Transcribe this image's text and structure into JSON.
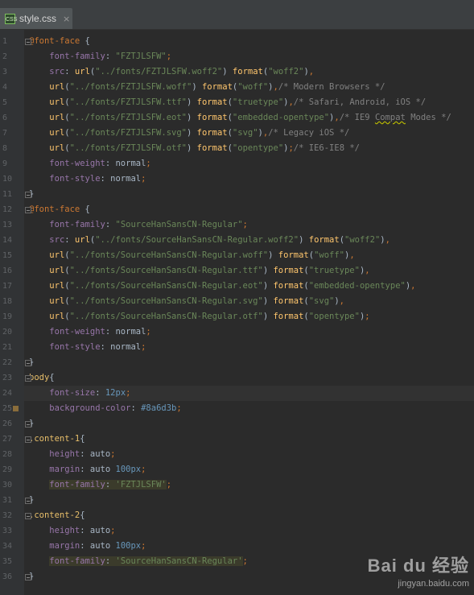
{
  "tab": {
    "icon": "css-file-icon",
    "icon_text": "CSS",
    "label": "style.css",
    "close": "×"
  },
  "watermark": {
    "logo": "Bai du 经验",
    "url": "jingyan.baidu.com"
  },
  "swatch_color": "#8a6d3b",
  "lines": [
    {
      "n": "1",
      "fold": true,
      "tokens": [
        [
          "at",
          "@font-face"
        ],
        [
          "plain",
          " {"
        ]
      ]
    },
    {
      "n": "2",
      "tokens": [
        [
          "sp",
          "    "
        ],
        [
          "prop",
          "font-family"
        ],
        [
          "plain",
          ": "
        ],
        [
          "str",
          "\"FZTJLSFW\""
        ],
        [
          "punc",
          ";"
        ]
      ]
    },
    {
      "n": "3",
      "tokens": [
        [
          "sp",
          "    "
        ],
        [
          "prop",
          "src"
        ],
        [
          "plain",
          ": "
        ],
        [
          "fn",
          "url"
        ],
        [
          "plain",
          "("
        ],
        [
          "str",
          "\"../fonts/FZTJLSFW.woff2\""
        ],
        [
          "plain",
          ") "
        ],
        [
          "fn",
          "format"
        ],
        [
          "plain",
          "("
        ],
        [
          "str",
          "\"woff2\""
        ],
        [
          "plain",
          ")"
        ],
        [
          "punc",
          ","
        ]
      ]
    },
    {
      "n": "4",
      "tokens": [
        [
          "sp",
          "    "
        ],
        [
          "fn",
          "url"
        ],
        [
          "plain",
          "("
        ],
        [
          "str",
          "\"../fonts/FZTJLSFW.woff\""
        ],
        [
          "plain",
          ") "
        ],
        [
          "fn",
          "format"
        ],
        [
          "plain",
          "("
        ],
        [
          "str",
          "\"woff\""
        ],
        [
          "plain",
          ")"
        ],
        [
          "punc",
          ","
        ],
        [
          "com",
          "/* Modern Browsers */"
        ]
      ]
    },
    {
      "n": "5",
      "tokens": [
        [
          "sp",
          "    "
        ],
        [
          "fn",
          "url"
        ],
        [
          "plain",
          "("
        ],
        [
          "str",
          "\"../fonts/FZTJLSFW.ttf\""
        ],
        [
          "plain",
          ") "
        ],
        [
          "fn",
          "format"
        ],
        [
          "plain",
          "("
        ],
        [
          "str",
          "\"truetype\""
        ],
        [
          "plain",
          ")"
        ],
        [
          "punc",
          ","
        ],
        [
          "com",
          "/* Safari, Android, iOS */"
        ]
      ]
    },
    {
      "n": "6",
      "tokens": [
        [
          "sp",
          "    "
        ],
        [
          "fn",
          "url"
        ],
        [
          "plain",
          "("
        ],
        [
          "str",
          "\"../fonts/FZTJLSFW.eot\""
        ],
        [
          "plain",
          ") "
        ],
        [
          "fn",
          "format"
        ],
        [
          "plain",
          "("
        ],
        [
          "str",
          "\"embedded-opentype\""
        ],
        [
          "plain",
          ")"
        ],
        [
          "punc",
          ","
        ],
        [
          "com",
          "/* IE9 "
        ],
        [
          "comsq",
          "Compat"
        ],
        [
          "com",
          " Modes */"
        ]
      ]
    },
    {
      "n": "7",
      "tokens": [
        [
          "sp",
          "    "
        ],
        [
          "fn",
          "url"
        ],
        [
          "plain",
          "("
        ],
        [
          "str",
          "\"../fonts/FZTJLSFW.svg\""
        ],
        [
          "plain",
          ") "
        ],
        [
          "fn",
          "format"
        ],
        [
          "plain",
          "("
        ],
        [
          "str",
          "\"svg\""
        ],
        [
          "plain",
          ")"
        ],
        [
          "punc",
          ","
        ],
        [
          "com",
          "/* Legacy iOS */"
        ]
      ]
    },
    {
      "n": "8",
      "tokens": [
        [
          "sp",
          "    "
        ],
        [
          "fn",
          "url"
        ],
        [
          "plain",
          "("
        ],
        [
          "str",
          "\"../fonts/FZTJLSFW.otf\""
        ],
        [
          "plain",
          ") "
        ],
        [
          "fn",
          "format"
        ],
        [
          "plain",
          "("
        ],
        [
          "str",
          "\"opentype\""
        ],
        [
          "plain",
          ")"
        ],
        [
          "punc",
          ";"
        ],
        [
          "com",
          "/* IE6-IE8 */"
        ]
      ]
    },
    {
      "n": "9",
      "tokens": [
        [
          "sp",
          "    "
        ],
        [
          "prop",
          "font-weight"
        ],
        [
          "plain",
          ": normal"
        ],
        [
          "punc",
          ";"
        ]
      ]
    },
    {
      "n": "10",
      "tokens": [
        [
          "sp",
          "    "
        ],
        [
          "prop",
          "font-style"
        ],
        [
          "plain",
          ": normal"
        ],
        [
          "punc",
          ";"
        ]
      ]
    },
    {
      "n": "11",
      "fold": true,
      "tokens": [
        [
          "plain",
          "}"
        ]
      ]
    },
    {
      "n": "12",
      "fold": true,
      "tokens": [
        [
          "at",
          "@font-face"
        ],
        [
          "plain",
          " {"
        ]
      ]
    },
    {
      "n": "13",
      "tokens": [
        [
          "sp",
          "    "
        ],
        [
          "prop",
          "font-family"
        ],
        [
          "plain",
          ": "
        ],
        [
          "str",
          "\"SourceHanSansCN-Regular\""
        ],
        [
          "punc",
          ";"
        ]
      ]
    },
    {
      "n": "14",
      "tokens": [
        [
          "sp",
          "    "
        ],
        [
          "prop",
          "src"
        ],
        [
          "plain",
          ": "
        ],
        [
          "fn",
          "url"
        ],
        [
          "plain",
          "("
        ],
        [
          "str",
          "\"../fonts/SourceHanSansCN-Regular.woff2\""
        ],
        [
          "plain",
          ") "
        ],
        [
          "fn",
          "format"
        ],
        [
          "plain",
          "("
        ],
        [
          "str",
          "\"woff2\""
        ],
        [
          "plain",
          ")"
        ],
        [
          "punc",
          ","
        ]
      ]
    },
    {
      "n": "15",
      "tokens": [
        [
          "sp",
          "    "
        ],
        [
          "fn",
          "url"
        ],
        [
          "plain",
          "("
        ],
        [
          "str",
          "\"../fonts/SourceHanSansCN-Regular.woff\""
        ],
        [
          "plain",
          ") "
        ],
        [
          "fn",
          "format"
        ],
        [
          "plain",
          "("
        ],
        [
          "str",
          "\"woff\""
        ],
        [
          "plain",
          ")"
        ],
        [
          "punc",
          ","
        ]
      ]
    },
    {
      "n": "16",
      "tokens": [
        [
          "sp",
          "    "
        ],
        [
          "fn",
          "url"
        ],
        [
          "plain",
          "("
        ],
        [
          "str",
          "\"../fonts/SourceHanSansCN-Regular.ttf\""
        ],
        [
          "plain",
          ") "
        ],
        [
          "fn",
          "format"
        ],
        [
          "plain",
          "("
        ],
        [
          "str",
          "\"truetype\""
        ],
        [
          "plain",
          ")"
        ],
        [
          "punc",
          ","
        ]
      ]
    },
    {
      "n": "17",
      "tokens": [
        [
          "sp",
          "    "
        ],
        [
          "fn",
          "url"
        ],
        [
          "plain",
          "("
        ],
        [
          "str",
          "\"../fonts/SourceHanSansCN-Regular.eot\""
        ],
        [
          "plain",
          ") "
        ],
        [
          "fn",
          "format"
        ],
        [
          "plain",
          "("
        ],
        [
          "str",
          "\"embedded-opentype\""
        ],
        [
          "plain",
          ")"
        ],
        [
          "punc",
          ","
        ]
      ]
    },
    {
      "n": "18",
      "tokens": [
        [
          "sp",
          "    "
        ],
        [
          "fn",
          "url"
        ],
        [
          "plain",
          "("
        ],
        [
          "str",
          "\"../fonts/SourceHanSansCN-Regular.svg\""
        ],
        [
          "plain",
          ") "
        ],
        [
          "fn",
          "format"
        ],
        [
          "plain",
          "("
        ],
        [
          "str",
          "\"svg\""
        ],
        [
          "plain",
          ")"
        ],
        [
          "punc",
          ","
        ]
      ]
    },
    {
      "n": "19",
      "tokens": [
        [
          "sp",
          "    "
        ],
        [
          "fn",
          "url"
        ],
        [
          "plain",
          "("
        ],
        [
          "str",
          "\"../fonts/SourceHanSansCN-Regular.otf\""
        ],
        [
          "plain",
          ") "
        ],
        [
          "fn",
          "format"
        ],
        [
          "plain",
          "("
        ],
        [
          "str",
          "\"opentype\""
        ],
        [
          "plain",
          ")"
        ],
        [
          "punc",
          ";"
        ]
      ]
    },
    {
      "n": "20",
      "tokens": [
        [
          "sp",
          "    "
        ],
        [
          "prop",
          "font-weight"
        ],
        [
          "plain",
          ": normal"
        ],
        [
          "punc",
          ";"
        ]
      ]
    },
    {
      "n": "21",
      "tokens": [
        [
          "sp",
          "    "
        ],
        [
          "prop",
          "font-style"
        ],
        [
          "plain",
          ": normal"
        ],
        [
          "punc",
          ";"
        ]
      ]
    },
    {
      "n": "22",
      "fold": true,
      "tokens": [
        [
          "plain",
          "}"
        ]
      ]
    },
    {
      "n": "23",
      "fold": true,
      "tokens": [
        [
          "sel",
          "body"
        ],
        [
          "plain",
          "{"
        ]
      ]
    },
    {
      "n": "24",
      "current": true,
      "tokens": [
        [
          "sp",
          "    "
        ],
        [
          "prop",
          "font-size"
        ],
        [
          "plain",
          ": "
        ],
        [
          "num",
          "12px"
        ],
        [
          "punc",
          ";"
        ]
      ]
    },
    {
      "n": "25",
      "swatch": true,
      "tokens": [
        [
          "sp",
          "    "
        ],
        [
          "prop",
          "background-color"
        ],
        [
          "plain",
          ": "
        ],
        [
          "num",
          "#8a6d3b"
        ],
        [
          "punc",
          ";"
        ]
      ]
    },
    {
      "n": "26",
      "fold": true,
      "tokens": [
        [
          "plain",
          "}"
        ]
      ]
    },
    {
      "n": "27",
      "fold": true,
      "tokens": [
        [
          "sel",
          ".content-1"
        ],
        [
          "plain",
          "{"
        ]
      ]
    },
    {
      "n": "28",
      "tokens": [
        [
          "sp",
          "    "
        ],
        [
          "prop",
          "height"
        ],
        [
          "plain",
          ": auto"
        ],
        [
          "punc",
          ";"
        ]
      ]
    },
    {
      "n": "29",
      "tokens": [
        [
          "sp",
          "    "
        ],
        [
          "prop",
          "margin"
        ],
        [
          "plain",
          ": auto "
        ],
        [
          "num",
          "100px"
        ],
        [
          "punc",
          ";"
        ]
      ]
    },
    {
      "n": "30",
      "tokens": [
        [
          "sp",
          "    "
        ],
        [
          "hlprop",
          "font-family"
        ],
        [
          "hlplain",
          ": "
        ],
        [
          "hlstr",
          "'FZTJLSFW'"
        ],
        [
          "punc",
          ";"
        ]
      ]
    },
    {
      "n": "31",
      "fold": true,
      "tokens": [
        [
          "plain",
          "}"
        ]
      ]
    },
    {
      "n": "32",
      "fold": true,
      "tokens": [
        [
          "sel",
          ".content-2"
        ],
        [
          "plain",
          "{"
        ]
      ]
    },
    {
      "n": "33",
      "tokens": [
        [
          "sp",
          "    "
        ],
        [
          "prop",
          "height"
        ],
        [
          "plain",
          ": auto"
        ],
        [
          "punc",
          ";"
        ]
      ]
    },
    {
      "n": "34",
      "tokens": [
        [
          "sp",
          "    "
        ],
        [
          "prop",
          "margin"
        ],
        [
          "plain",
          ": auto "
        ],
        [
          "num",
          "100px"
        ],
        [
          "punc",
          ";"
        ]
      ]
    },
    {
      "n": "35",
      "tokens": [
        [
          "sp",
          "    "
        ],
        [
          "hlprop",
          "font-family"
        ],
        [
          "hlplain",
          ": "
        ],
        [
          "hlstr",
          "'SourceHanSansCN-Regular'"
        ],
        [
          "punc",
          ";"
        ]
      ]
    },
    {
      "n": "36",
      "fold": true,
      "tokens": [
        [
          "plain",
          "}"
        ]
      ]
    }
  ]
}
